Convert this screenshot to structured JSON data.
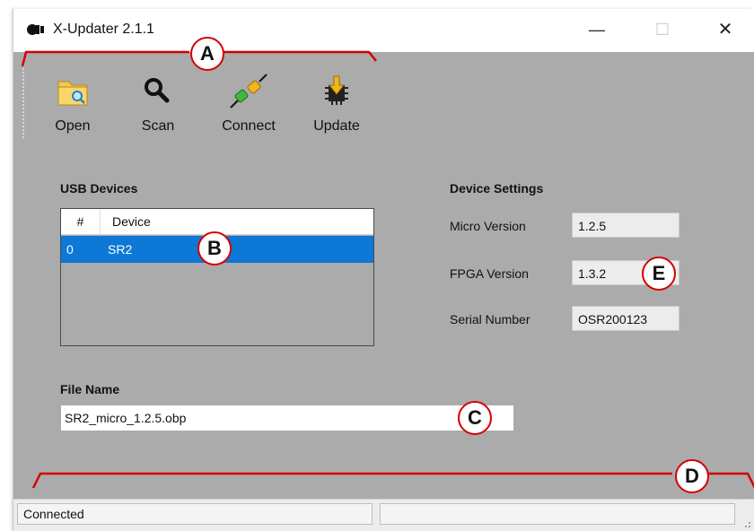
{
  "window": {
    "title": "X-Updater  2.1.1",
    "controls": {
      "minimize": "—",
      "maximize": "☐",
      "close": "✕"
    }
  },
  "toolbar": {
    "buttons": [
      {
        "label": "Open",
        "icon": "folder-search-icon"
      },
      {
        "label": "Scan",
        "icon": "magnifier-icon"
      },
      {
        "label": "Connect",
        "icon": "plug-connect-icon"
      },
      {
        "label": "Update",
        "icon": "chip-download-icon"
      }
    ]
  },
  "usb_devices": {
    "title": "USB Devices",
    "columns": [
      "#",
      "Device"
    ],
    "rows": [
      {
        "num": "0",
        "device": "SR2"
      }
    ]
  },
  "device_settings": {
    "title": "Device Settings",
    "fields": [
      {
        "label": "Micro Version",
        "value": "1.2.5"
      },
      {
        "label": "FPGA Version",
        "value": "1.3.2"
      },
      {
        "label": "Serial Number",
        "value": "OSR200123"
      }
    ]
  },
  "file": {
    "title": "File Name",
    "value": "SR2_micro_1.2.5.obp"
  },
  "status": {
    "text": "Connected",
    "secondary": ""
  },
  "callouts": [
    "A",
    "B",
    "C",
    "D",
    "E"
  ],
  "colors": {
    "callout_red": "#d40000",
    "selection_blue": "#0d78d6",
    "window_gray": "#ababab"
  }
}
